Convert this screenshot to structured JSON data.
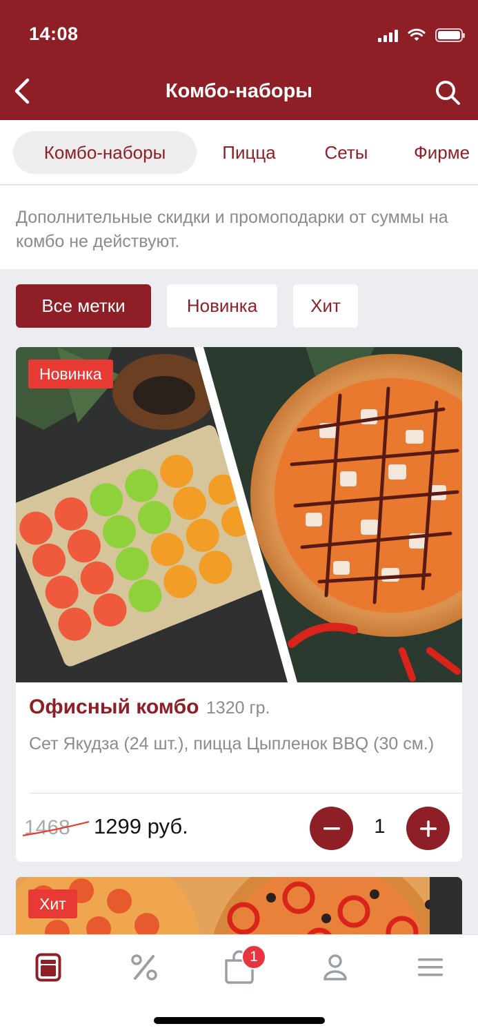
{
  "status_bar": {
    "time": "14:08"
  },
  "header": {
    "title": "Комбо-наборы"
  },
  "category_tabs": [
    {
      "label": "Комбо-наборы",
      "active": true
    },
    {
      "label": "Пицца",
      "active": false
    },
    {
      "label": "Сеты",
      "active": false
    },
    {
      "label": "Фирме",
      "active": false
    }
  ],
  "notice": "Дополнительные скидки и промоподарки от суммы на комбо не действуют.",
  "filters": [
    {
      "label": "Все метки",
      "active": true
    },
    {
      "label": "Новинка",
      "active": false
    },
    {
      "label": "Хит",
      "active": false
    }
  ],
  "products": [
    {
      "badge": "Новинка",
      "title": "Офисный комбо",
      "weight": "1320 гр.",
      "description": "Сет Якудза (24 шт.), пицца Цыпленок BBQ (30 см.)",
      "old_price": "1468",
      "price": "1299 руб.",
      "quantity": "1"
    },
    {
      "badge": "Хит"
    }
  ],
  "tabbar": {
    "cart_badge": "1",
    "items": [
      "menu-icon",
      "percent-icon",
      "cart-icon",
      "profile-icon",
      "hamburger-icon"
    ]
  },
  "colors": {
    "brand": "#8e1f26",
    "badge": "#e83a35",
    "background": "#ecedf1"
  }
}
